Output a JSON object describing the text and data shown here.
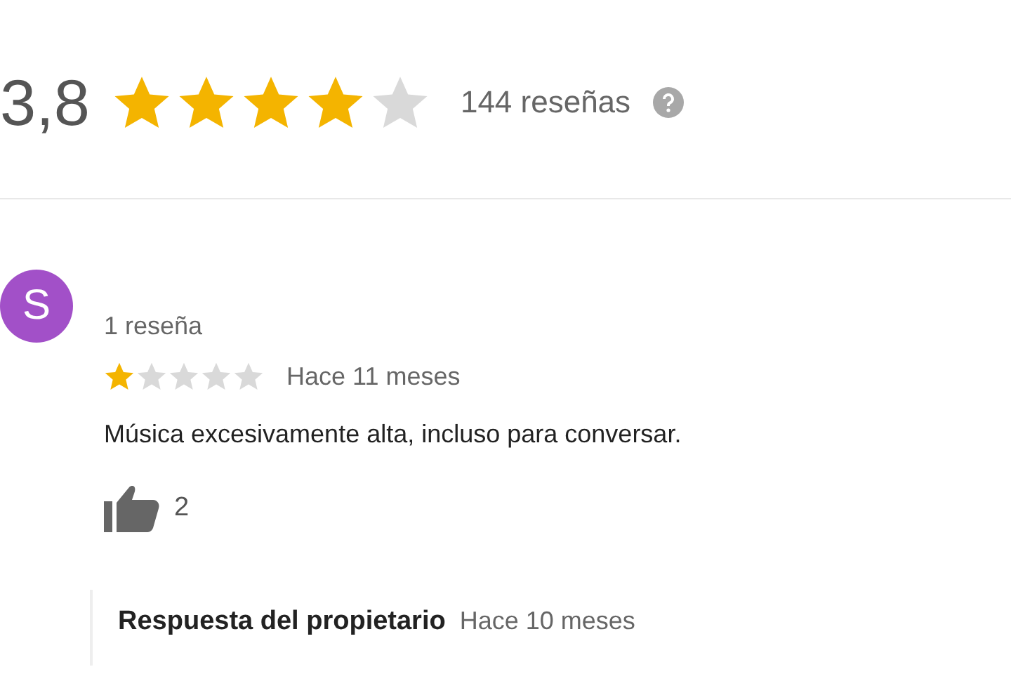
{
  "summary": {
    "rating": "3,8",
    "stars": 4,
    "count": "144 reseñas"
  },
  "review": {
    "avatar_letter": "S",
    "author_reviews": "1 reseña",
    "stars": 1,
    "time": "Hace 11 meses",
    "text": "Música excesivamente alta, incluso para conversar.",
    "likes": "2"
  },
  "owner_reply": {
    "title": "Respuesta del propietario",
    "time": "Hace 10 meses"
  }
}
